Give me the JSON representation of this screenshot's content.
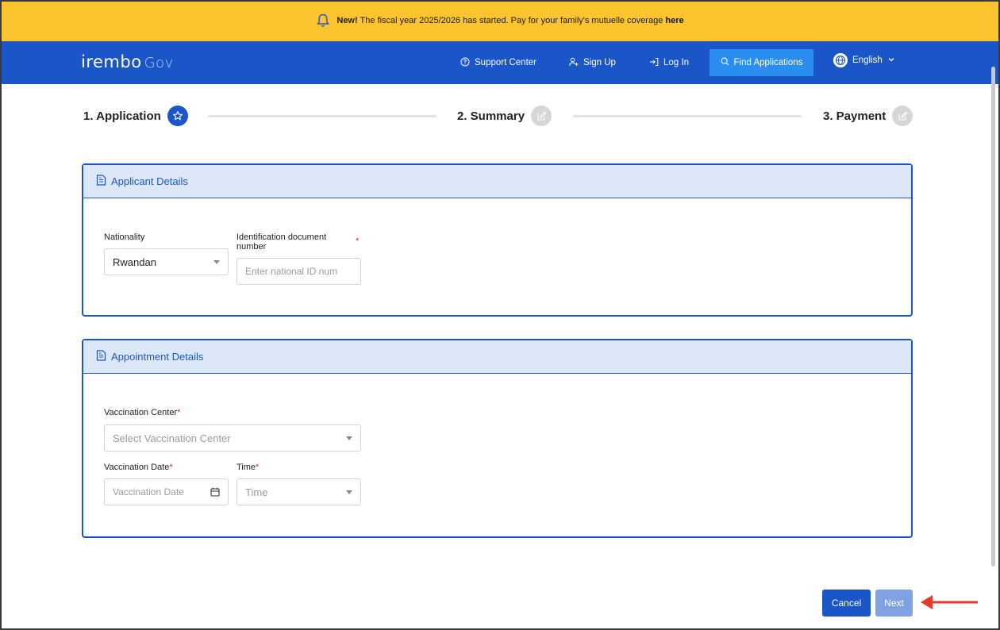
{
  "banner": {
    "new_label": "New!",
    "text": "The fiscal year 2025/2026 has started. Pay for your family's mutuelle coverage",
    "link": "here"
  },
  "navbar": {
    "logo_main": "irembo",
    "logo_sub": "Gov",
    "support": "Support Center",
    "signup": "Sign Up",
    "login": "Log In",
    "find": "Find Applications",
    "language": "English"
  },
  "stepper": {
    "steps": [
      {
        "label": "1. Application",
        "state": "active"
      },
      {
        "label": "2. Summary",
        "state": "inactive"
      },
      {
        "label": "3. Payment",
        "state": "inactive"
      }
    ]
  },
  "applicant": {
    "title": "Applicant Details",
    "nationality_label": "Nationality",
    "nationality_value": "Rwandan",
    "id_label": "Identification document number",
    "id_placeholder": "Enter national ID num",
    "required_mark": "*"
  },
  "appointment": {
    "title": "Appointment Details",
    "center_label": "Vaccination Center",
    "center_placeholder": "Select Vaccination Center",
    "date_label": "Vaccination Date",
    "date_placeholder": "Vaccination Date",
    "time_label": "Time",
    "time_placeholder": "Time",
    "required_mark": "*"
  },
  "actions": {
    "cancel": "Cancel",
    "next": "Next"
  },
  "colors": {
    "banner": "#fcc52f",
    "navbar": "#1b56c9",
    "find_button": "#2a8ef1",
    "panel_header": "#dce8f8",
    "annotation_arrow": "#e53a2a"
  }
}
